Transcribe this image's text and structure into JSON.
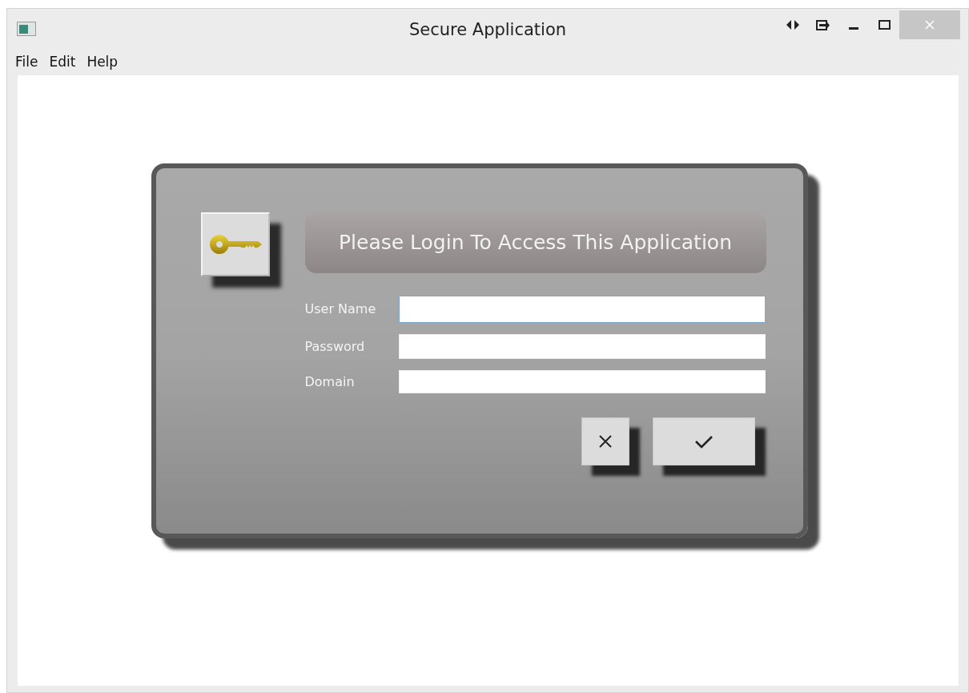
{
  "window": {
    "title": "Secure Application",
    "controls": [
      {
        "kind": "restore-side"
      },
      {
        "kind": "dock"
      },
      {
        "kind": "minimize"
      },
      {
        "kind": "maximize"
      },
      {
        "kind": "close"
      }
    ]
  },
  "menu": [
    "File",
    "Edit",
    "Help"
  ],
  "login": {
    "heading": "Please Login To Access This Application",
    "fields": [
      {
        "label": "User Name",
        "focused": true
      },
      {
        "label": "Password",
        "focused": false
      },
      {
        "label": "Domain",
        "focused": false
      }
    ],
    "buttons": [
      {
        "kind": "cancel"
      },
      {
        "kind": "ok"
      }
    ]
  }
}
